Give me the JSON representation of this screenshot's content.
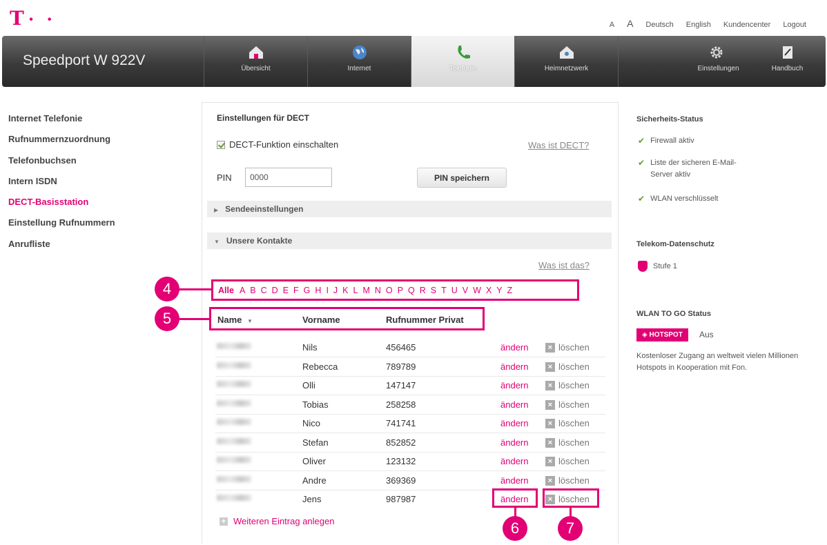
{
  "header": {
    "logo_text": "T",
    "logo_dots": "· ·",
    "top_links": [
      "A",
      "A",
      "Deutsch",
      "English",
      "Kundencenter",
      "Logout"
    ]
  },
  "navbar": {
    "brand": "Speedport W 922V",
    "items": [
      {
        "label": "Übersicht",
        "icon": "home-icon"
      },
      {
        "label": "Internet",
        "icon": "globe-icon"
      },
      {
        "label": "Telefonie",
        "icon": "phone-icon"
      },
      {
        "label": "Heimnetzwerk",
        "icon": "home-network-icon"
      },
      {
        "label": "Einstellungen",
        "icon": "gear-icon"
      },
      {
        "label": "Handbuch",
        "icon": "book-icon"
      }
    ],
    "active": "Telefonie"
  },
  "sidebar": {
    "items": [
      "Internet Telefonie",
      "Rufnummernzuordnung",
      "Telefonbuchsen",
      "Intern ISDN",
      "DECT-Basisstation",
      "Einstellung Rufnummern",
      "Anrufliste"
    ],
    "active": "DECT-Basisstation"
  },
  "main": {
    "title": "Einstellungen für DECT",
    "dect_checkbox_label": "DECT-Funktion einschalten",
    "dect_help_link": "Was ist DECT?",
    "pin_label": "PIN",
    "pin_value": "0000",
    "pin_button": "PIN speichern",
    "section_send": "Sendeeinstellungen",
    "section_contacts": "Unsere Kontakte",
    "contacts_help_link": "Was ist das?",
    "alphabet": [
      "Alle",
      "A",
      "B",
      "C",
      "D",
      "E",
      "F",
      "G",
      "H",
      "I",
      "J",
      "K",
      "L",
      "M",
      "N",
      "O",
      "P",
      "Q",
      "R",
      "S",
      "T",
      "U",
      "V",
      "W",
      "X",
      "Y",
      "Z"
    ],
    "columns": {
      "name": "Name",
      "sort_indicator": "▼",
      "vorname": "Vorname",
      "tel": "Rufnummer Privat"
    },
    "contacts": [
      {
        "vorname": "Nils",
        "tel": "456465"
      },
      {
        "vorname": "Rebecca",
        "tel": "789789"
      },
      {
        "vorname": "Olli",
        "tel": "147147"
      },
      {
        "vorname": "Tobias",
        "tel": "258258"
      },
      {
        "vorname": "Nico",
        "tel": "741741"
      },
      {
        "vorname": "Stefan",
        "tel": "852852"
      },
      {
        "vorname": "Oliver",
        "tel": "123132"
      },
      {
        "vorname": "Andre",
        "tel": "369369"
      },
      {
        "vorname": "Jens",
        "tel": "987987"
      }
    ],
    "edit_label": "ändern",
    "delete_label": "löschen",
    "delete_icon": "×",
    "new_entry": "Weiteren Eintrag anlegen",
    "new_entry_icon": "+"
  },
  "callouts": {
    "c4": "4",
    "c5": "5",
    "c6": "6",
    "c7": "7"
  },
  "right": {
    "security_title": "Sicherheits-Status",
    "security_items": [
      "Firewall aktiv",
      "Liste der sicheren E-Mail-Server aktiv",
      "WLAN verschlüsselt"
    ],
    "privacy_title": "Telekom-Datenschutz",
    "privacy_level": "Stufe 1",
    "wlan_title": "WLAN TO GO Status",
    "hotspot_label": "HOTSPOT",
    "hotspot_state": "Aus",
    "wlan_text": "Kostenloser Zugang an weltweit vielen Millionen Hotspots in Kooperation mit Fon."
  },
  "colors": {
    "accent": "#e20074",
    "ok": "#6a9a26"
  }
}
